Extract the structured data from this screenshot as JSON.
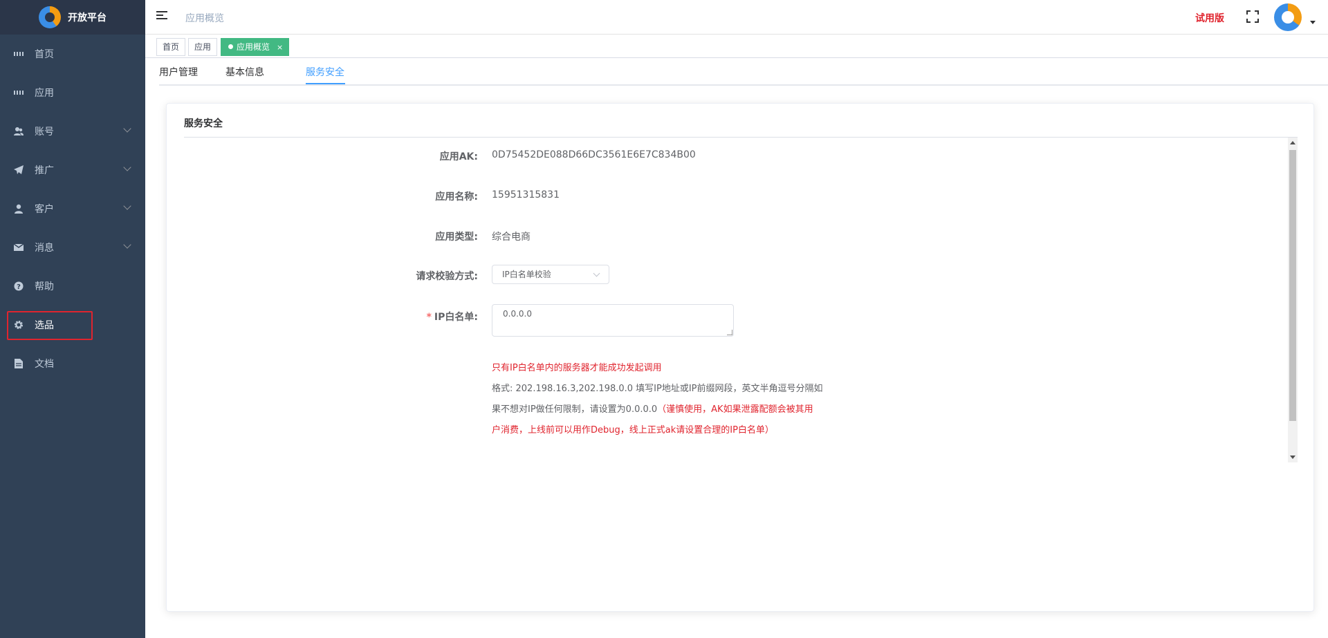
{
  "app": {
    "title": "开放平台"
  },
  "sidebar": {
    "items": [
      {
        "label": "首页",
        "icon": "dashboard-icon",
        "has_children": false
      },
      {
        "label": "应用",
        "icon": "app-grid-icon",
        "has_children": false
      },
      {
        "label": "账号",
        "icon": "users-icon",
        "has_children": true
      },
      {
        "label": "推广",
        "icon": "paper-plane-icon",
        "has_children": true
      },
      {
        "label": "客户",
        "icon": "user-icon",
        "has_children": true
      },
      {
        "label": "消息",
        "icon": "envelope-icon",
        "has_children": true
      },
      {
        "label": "帮助",
        "icon": "question-icon",
        "has_children": false
      },
      {
        "label": "选品",
        "icon": "gear-icon",
        "has_children": false
      },
      {
        "label": "文档",
        "icon": "document-icon",
        "has_children": false
      }
    ]
  },
  "navbar": {
    "breadcrumb": "应用概览",
    "trial_label": "试用版"
  },
  "tags_view": {
    "tags": [
      {
        "label": "首页",
        "active": false
      },
      {
        "label": "应用",
        "active": false
      },
      {
        "label": "应用概览",
        "active": true,
        "close": "×"
      }
    ]
  },
  "tabs": [
    {
      "label": "用户管理",
      "active": false
    },
    {
      "label": "基本信息",
      "active": false
    },
    {
      "label": "服务安全",
      "active": true
    }
  ],
  "card": {
    "title": "服务安全",
    "fields": {
      "ak_label": "应用AK:",
      "ak_value": "0D75452DE088D66DC3561E6E7C834B00",
      "name_label": "应用名称:",
      "name_value": "15951315831",
      "type_label": "应用类型:",
      "type_value": "综合电商",
      "verify_label": "请求校验方式:",
      "verify_value": "IP白名单校验",
      "whitelist_required": "*",
      "whitelist_label": "IP白名单:",
      "whitelist_value": "0.0.0.0"
    },
    "hints": {
      "line1": "只有IP白名单内的服务器才能成功发起调用",
      "line2": "格式: 202.198.16.3,202.198.0.0 填写IP地址或IP前缀网段，英文半角逗号分隔如",
      "line3_normal": "果不想对IP做任何限制，请设置为0.0.0.0",
      "line3_red": "（谨慎使用，AK如果泄露配额会被其用",
      "line4": "户消费，上线前可以用作Debug，线上正式ak请设置合理的IP白名单）"
    }
  },
  "colors": {
    "sidebar_bg": "#304156",
    "accent": "#409eff",
    "active_tag": "#42b983",
    "warning": "#e0242e"
  }
}
